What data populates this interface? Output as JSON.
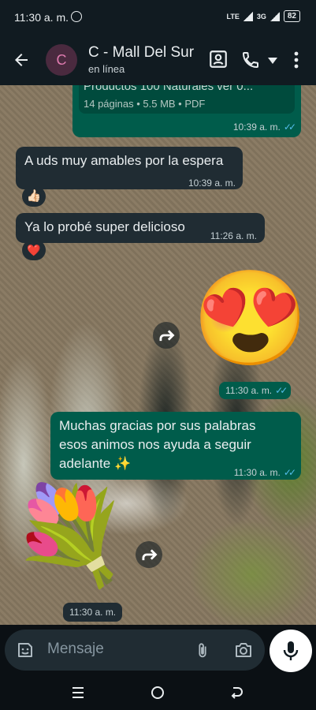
{
  "status_bar": {
    "time": "11:30 a. m.",
    "network_lte": "LTE",
    "network_3g": "3G",
    "battery": "82"
  },
  "header": {
    "avatar_letter": "C",
    "contact_name": "C - Mall Del Sur",
    "contact_status": "en línea"
  },
  "messages": {
    "doc": {
      "title": "Productos 100 Naturales ver 0...",
      "meta": "14 páginas • 5.5 MB • PDF",
      "time": "10:39 a. m."
    },
    "m1": {
      "text": "A uds muy amables por la espera",
      "time": "10:39 a. m.",
      "reaction": "👍🏻"
    },
    "m2": {
      "text": "Ya lo probé super delicioso",
      "time": "11:26 a. m.",
      "reaction": "❤️"
    },
    "sticker1": {
      "emoji": "😍",
      "time": "11:30 a. m."
    },
    "m3": {
      "text": "Muchas gracias por sus palabras esos animos nos ayuda a seguir adelante ✨",
      "time": "11:30 a. m."
    },
    "sticker2": {
      "emoji": "💐",
      "time": "11:30 a. m."
    }
  },
  "composer": {
    "placeholder": "Mensaje"
  },
  "colors": {
    "outgoing": "#005c4b",
    "incoming": "#202c33",
    "header": "#111b21",
    "read_tick": "#53bdeb"
  },
  "icons": [
    "back-arrow-icon",
    "contact-card-icon",
    "phone-icon",
    "dropdown-icon",
    "more-vert-icon",
    "forward-icon",
    "sticker-icon",
    "attach-icon",
    "camera-icon",
    "mic-icon",
    "nav-menu-icon",
    "nav-home-icon",
    "nav-back-icon"
  ]
}
